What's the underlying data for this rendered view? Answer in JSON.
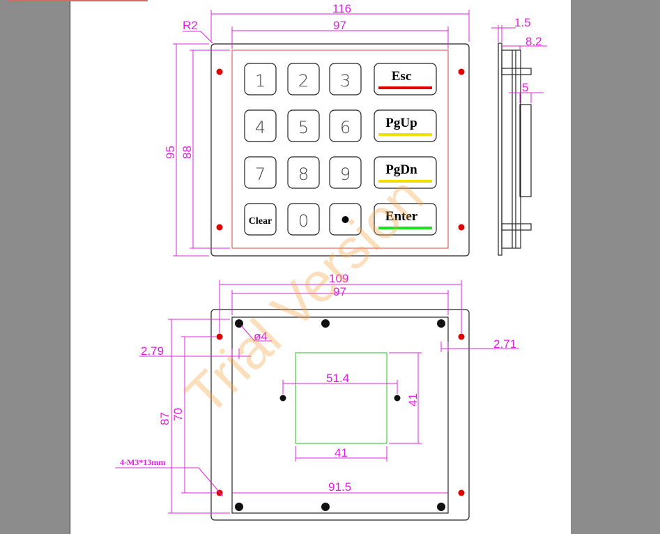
{
  "watermark": "Trial Version",
  "top_view": {
    "dims": {
      "width_outer": "116",
      "width_inner": "97",
      "height_outer": "95",
      "height_inner": "88",
      "radius": "R2"
    },
    "keys": [
      "1",
      "2",
      "3",
      "4",
      "5",
      "6",
      "7",
      "8",
      "9",
      "Clear",
      "0",
      "•"
    ],
    "function_keys": [
      {
        "label": "Esc",
        "color": "#e00000"
      },
      {
        "label": "PgUp",
        "color": "#f0e000"
      },
      {
        "label": "PgDn",
        "color": "#f0e000"
      },
      {
        "label": "Enter",
        "color": "#20e020"
      }
    ]
  },
  "side_view": {
    "dims": {
      "plate": "1.5",
      "depth": "8.2",
      "offset": "5"
    }
  },
  "bottom_view": {
    "dims": {
      "width_holes": "109",
      "width_inner": "97",
      "hole_dia": "ø4",
      "left_offset": "2.79",
      "right_offset": "2.71",
      "height_outer": "87",
      "height_holes": "70",
      "screw_label": "4-M3*13mm",
      "window_w_holes": "51.4",
      "window_h": "41",
      "window_w": "41",
      "bottom_width": "91.5"
    }
  },
  "colors": {
    "dimension": "#e020e0",
    "hole": "#e00000",
    "window": "#20c020",
    "outline": "#222222"
  }
}
